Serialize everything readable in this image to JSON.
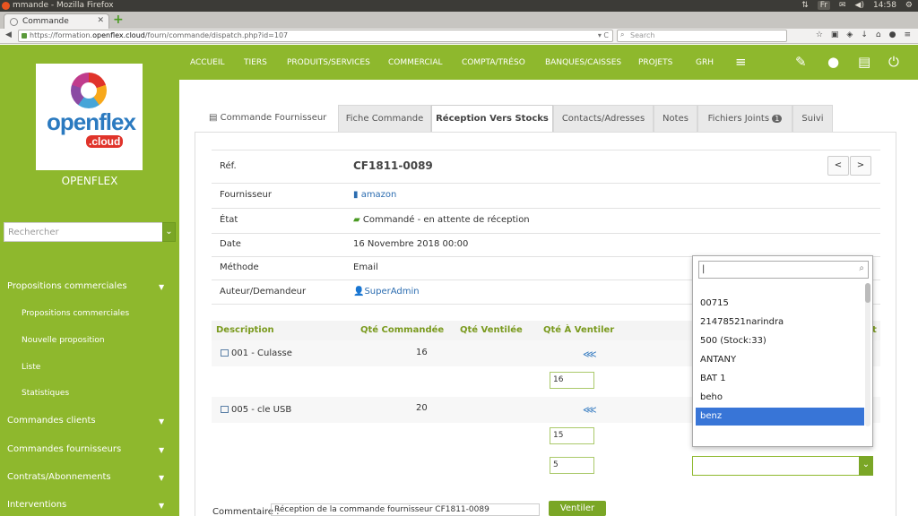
{
  "os": {
    "window_title": "mmande - Mozilla Firefox",
    "lang": "Fr",
    "time": "14:58"
  },
  "browser": {
    "tab_title": "Commande",
    "url_prefix": "https://formation.",
    "url_host": "openflex.cloud",
    "url_path": "/fourn/commande/dispatch.php?id=107",
    "search_placeholder": "Search"
  },
  "sidebar": {
    "brand": "OPENFLEX",
    "logo_word": "openflex",
    "logo_sub": ".cloud",
    "search_placeholder": "Rechercher",
    "menu": [
      {
        "label": "Propositions commerciales"
      },
      {
        "label": "Propositions commerciales"
      },
      {
        "label": "Nouvelle proposition"
      },
      {
        "label": "Liste"
      },
      {
        "label": "Statistiques"
      },
      {
        "label": "Commandes clients"
      },
      {
        "label": "Commandes fournisseurs"
      },
      {
        "label": "Contrats/Abonnements"
      },
      {
        "label": "Interventions"
      }
    ]
  },
  "topmenu": [
    "ACCUEIL",
    "TIERS",
    "PRODUITS/SERVICES",
    "COMMERCIAL",
    "COMPTA/TRÉSO",
    "BANQUES/CAISSES",
    "PROJETS",
    "GRH"
  ],
  "tabs": [
    "Commande Fournisseur",
    "Fiche Commande",
    "Réception Vers Stocks",
    "Contacts/Adresses",
    "Notes",
    "Fichiers Joints",
    "Suivi"
  ],
  "tabs_badge": "1",
  "info": {
    "ref_label": "Réf.",
    "ref": "CF1811-0089",
    "supplier_label": "Fournisseur",
    "supplier": "amazon",
    "state_label": "État",
    "state": "Commandé - en attente de réception",
    "date_label": "Date",
    "date": "16 Novembre 2018 00:00",
    "method_label": "Méthode",
    "method": "Email",
    "author_label": "Auteur/Demandeur",
    "author": "SuperAdmin",
    "prev": "<",
    "next": ">"
  },
  "lines": {
    "headers": [
      "Description",
      "Qté Commandée",
      "Qté Ventilée",
      "Qté À Ventiler"
    ],
    "header_tail": "t",
    "rows": [
      {
        "desc": "001 - Culasse",
        "ordered": "16",
        "qty": "16"
      },
      {
        "desc": "005 - cle USB",
        "ordered": "20",
        "qty": "15",
        "qty2": "5"
      }
    ]
  },
  "dropdown": {
    "options": [
      "00715",
      "21478521narindra",
      "500 (Stock:33)",
      "ANTANY",
      "BAT 1",
      "beho",
      "benz"
    ],
    "highlighted": "benz"
  },
  "comment": {
    "label": "Commentaire :",
    "value": "Réception de la commande fournisseur CF1811-0089"
  },
  "ventiler_label": "Ventiler"
}
